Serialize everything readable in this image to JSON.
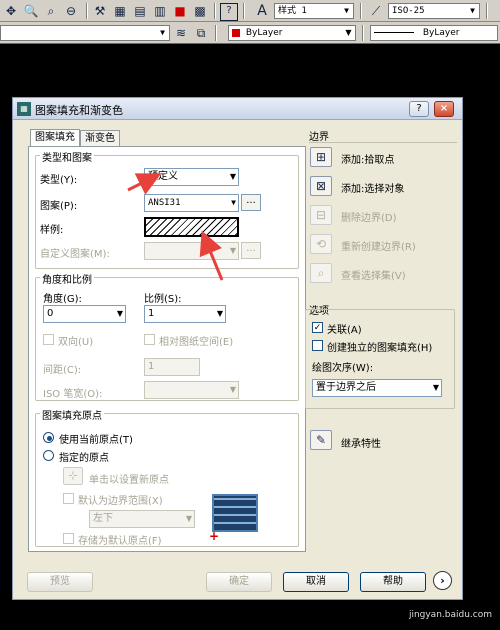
{
  "toolbar1": {
    "text_style_label": "样式 1",
    "dim_style_label": "ISO-25"
  },
  "toolbar2": {
    "color_label": "ByLayer",
    "linetype_label": "ByLayer"
  },
  "dialog": {
    "title": "图案填充和渐变色",
    "help_glyph": "?",
    "close_glyph": "×",
    "tabs": [
      "图案填充",
      "渐变色"
    ],
    "type_pattern": {
      "group_title": "类型和图案",
      "type_label": "类型(Y):",
      "type_value": "预定义",
      "pattern_label": "图案(P):",
      "pattern_value": "ANSI31",
      "swatch_label": "样例:",
      "custom_label": "自定义图案(M):",
      "ellipsis": "..."
    },
    "angle_scale": {
      "group_title": "角度和比例",
      "angle_label": "角度(G):",
      "angle_value": "0",
      "scale_label": "比例(S):",
      "scale_value": "1",
      "double_label": "双向(U)",
      "relative_label": "相对图纸空间(E)",
      "spacing_label": "间距(C):",
      "spacing_value": "1",
      "iso_label": "ISO 笔宽(O):"
    },
    "origin": {
      "group_title": "图案填充原点",
      "current_label": "使用当前原点(T)",
      "specified_label": "指定的原点",
      "click_set_label": "单击以设置新原点",
      "default_extents_label": "默认为边界范围(X)",
      "position_value": "左下",
      "store_default_label": "存储为默认原点(F)"
    },
    "boundaries": {
      "group_title": "边界",
      "add_pick_label": "添加:拾取点",
      "add_select_label": "添加:选择对象",
      "remove_label": "删除边界(D)",
      "recreate_label": "重新创建边界(R)",
      "view_label": "查看选择集(V)"
    },
    "options": {
      "group_title": "选项",
      "associative_label": "关联(A)",
      "separate_label": "创建独立的图案填充(H)",
      "draw_order_label": "绘图次序(W):",
      "draw_order_value": "置于边界之后"
    },
    "inherit_label": "继承特性",
    "buttons": {
      "preview": "预览",
      "ok": "确定",
      "cancel": "取消",
      "help": "帮助"
    }
  },
  "watermark": "jingyan.baidu.com",
  "colors": {
    "annotation_arrow": "#e8413c",
    "dialog_bg": "#ece9d8",
    "accent": "#1c5180"
  }
}
